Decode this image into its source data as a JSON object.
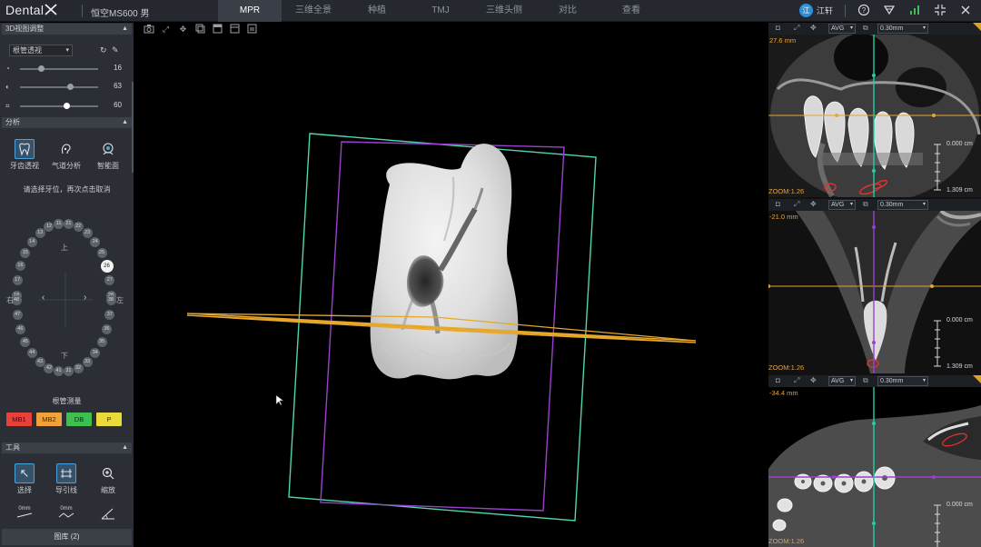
{
  "app": {
    "brand": "Dental",
    "patient": "恒空MS600 男"
  },
  "tabs": [
    {
      "label": "MPR",
      "active": true
    },
    {
      "label": "三维全景"
    },
    {
      "label": "种植"
    },
    {
      "label": "TMJ"
    },
    {
      "label": "三维头侧"
    },
    {
      "label": "对比"
    },
    {
      "label": "查看"
    }
  ],
  "user": {
    "avatar": "江",
    "name": "江轩"
  },
  "topbar_icons": [
    "help-icon",
    "filter-icon",
    "signal-icon",
    "collapse-icon",
    "close-icon"
  ],
  "left": {
    "section_3d": "3D视图调整",
    "view_select": "根管透视",
    "sliders": [
      {
        "icon": "brightness-icon",
        "value": "16",
        "level": 0.25
      },
      {
        "icon": "contrast-icon",
        "value": "63",
        "level": 0.63
      },
      {
        "icon": "crop-icon",
        "value": "60",
        "level": 0.6
      }
    ],
    "section_analysis": "分析",
    "analysis_tools": [
      {
        "label": "牙齿透视",
        "icon": "tooth-icon",
        "selected": true
      },
      {
        "label": "气道分析",
        "icon": "airway-icon"
      },
      {
        "label": "智能面",
        "icon": "face-icon"
      }
    ],
    "hint": "请选择牙位，再次点击取消",
    "chart": {
      "upper": "上",
      "lower": "下",
      "right": "右",
      "left": "左",
      "selected_tooth": "26"
    },
    "upper_teeth": [
      "18",
      "17",
      "16",
      "15",
      "14",
      "13",
      "12",
      "11",
      "21",
      "22",
      "23",
      "24",
      "25",
      "26",
      "27",
      "28"
    ],
    "lower_teeth": [
      "48",
      "47",
      "46",
      "45",
      "44",
      "43",
      "42",
      "41",
      "31",
      "32",
      "33",
      "34",
      "35",
      "36",
      "37",
      "38"
    ],
    "canal_title": "根管测量",
    "canals": [
      {
        "label": "MB1",
        "color": "#e8413c"
      },
      {
        "label": "MB2",
        "color": "#f0a23a"
      },
      {
        "label": "DB",
        "color": "#3fbf4f"
      },
      {
        "label": "P",
        "color": "#e9d93a"
      }
    ],
    "section_tools": "工具",
    "tools": [
      {
        "label": "选择",
        "icon": "cursor-icon",
        "selected": true
      },
      {
        "label": "导引线",
        "icon": "guide-line-icon"
      },
      {
        "label": "缩放",
        "icon": "zoom-icon"
      }
    ],
    "tools_row2": [
      {
        "label": "0mm",
        "icon": "ruler-icon"
      },
      {
        "label": "0mm",
        "icon": "polyline-icon"
      },
      {
        "label": "",
        "icon": "angle-icon"
      }
    ],
    "bottom_button": "图库 (2)"
  },
  "main": {
    "tool_icons": [
      "camera-icon",
      "expand-icon",
      "move-icon",
      "layer-icon",
      "layer2-icon",
      "window-icon",
      "export-icon"
    ],
    "colors": {
      "green_box": "#4fd6b0",
      "purple_box": "#9b3fd1",
      "yellow_line": "#e6a72a"
    }
  },
  "right_panels": [
    {
      "depth": "27.6 mm",
      "zoom": "ZOOM:1.26",
      "mode": "AVG",
      "thickness": "0.30mm",
      "scale_top": "0.000 cm",
      "scale_bottom": "1.309 cm"
    },
    {
      "depth": "-21.0 mm",
      "zoom": "ZOOM:1.26",
      "mode": "AVG",
      "thickness": "0.30mm",
      "scale_top": "0.000 cm",
      "scale_bottom": "1.309 cm"
    },
    {
      "depth": "-34.4 mm",
      "zoom": "ZOOM:1.26",
      "mode": "AVG",
      "thickness": "0.30mm",
      "scale_top": "0.000 cm",
      "scale_bottom": ""
    }
  ]
}
